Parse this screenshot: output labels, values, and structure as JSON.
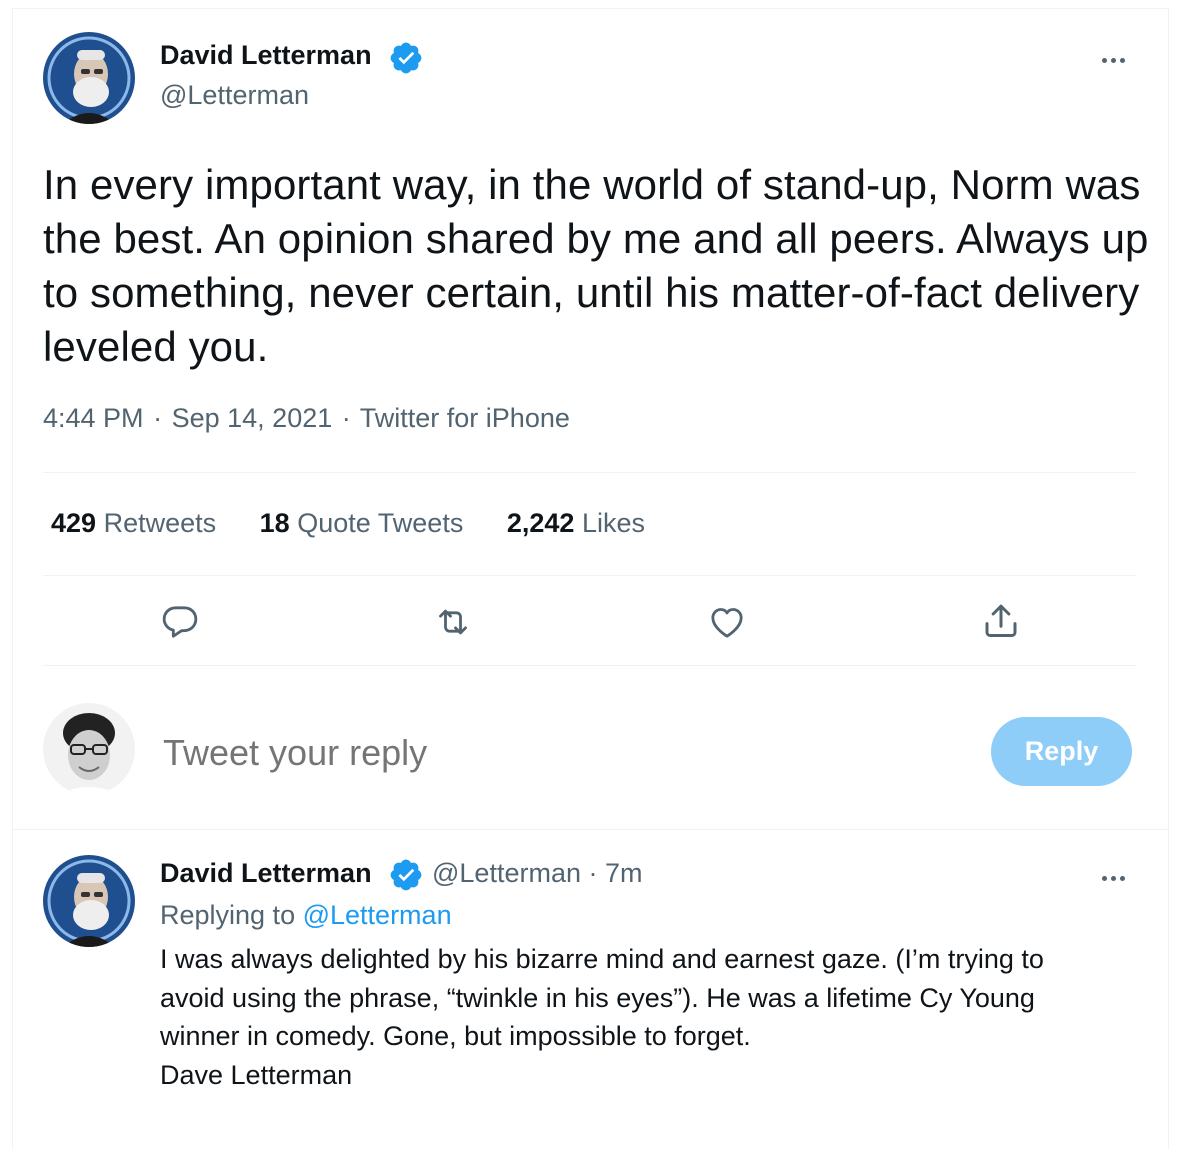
{
  "tweet": {
    "author_name": "David Letterman",
    "author_handle": "@Letterman",
    "text": "In every important way, in the world of stand-up, Norm was the best.  An opinion shared by me and all peers.  Always up to something, never certain, until his matter-of-fact delivery leveled you.",
    "time": "4:44 PM",
    "date": "Sep 14, 2021",
    "source": "Twitter for iPhone",
    "separator": "·",
    "stats": [
      {
        "count": "429",
        "label": "Retweets"
      },
      {
        "count": "18",
        "label": "Quote Tweets"
      },
      {
        "count": "2,242",
        "label": "Likes"
      }
    ]
  },
  "compose": {
    "placeholder": "Tweet your reply",
    "button_label": "Reply"
  },
  "reply": {
    "author_name": "David Letterman",
    "author_handle": "@Letterman",
    "separator": "·",
    "time_ago": "7m",
    "replying_prefix": "Replying to",
    "replying_handle": "@Letterman",
    "lines": [
      "I was always delighted by his bizarre mind and earnest gaze.  (I’m trying to",
      "avoid using the phrase, “twinkle in his eyes”).  He was a lifetime Cy Young",
      "winner in comedy.  Gone, but impossible to forget.",
      "Dave Letterman"
    ]
  },
  "colors": {
    "accent": "#1d9bf0",
    "reply_button_disabled": "#8ecdf8",
    "secondary_text": "#536471"
  },
  "icons": [
    "verified-badge-icon",
    "more-icon",
    "reply-icon",
    "retweet-icon",
    "like-icon",
    "share-icon"
  ]
}
